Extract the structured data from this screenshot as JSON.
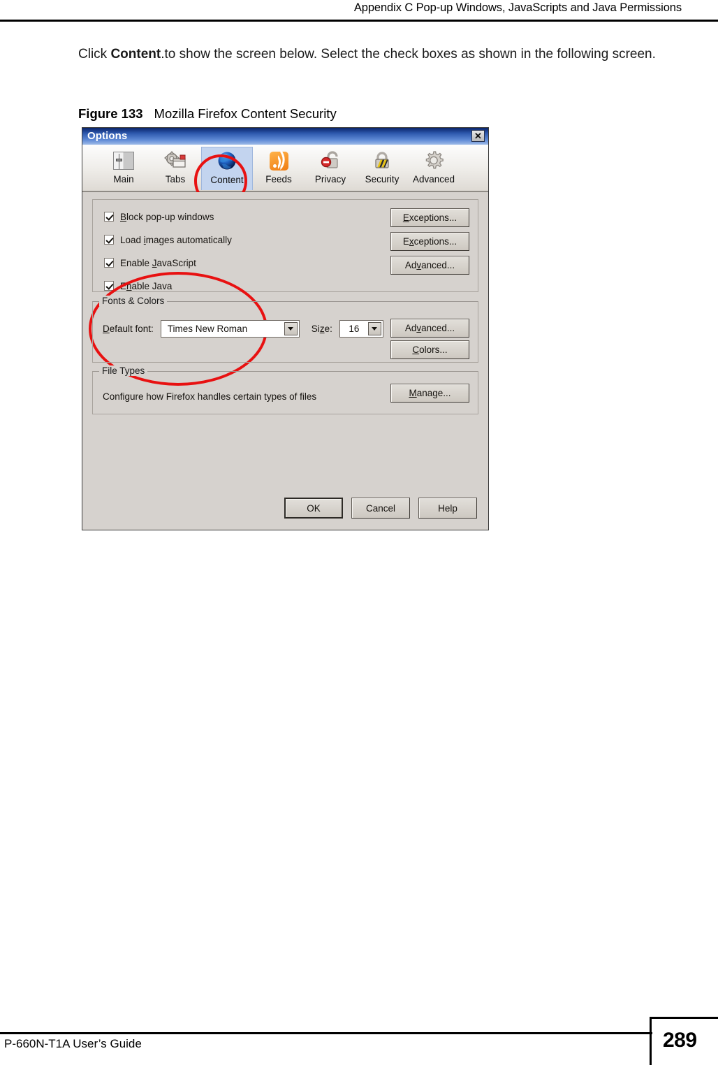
{
  "page": {
    "header": "Appendix C Pop-up Windows, JavaScripts and Java Permissions",
    "intro_before": "Click ",
    "intro_bold": "Content",
    "intro_after": ".to show the screen below. Select the check boxes as shown in the following screen.",
    "figure_number": "Figure 133",
    "figure_title": "Mozilla Firefox Content Security",
    "footer_left": "P-660N-T1A User’s Guide",
    "footer_page": "289"
  },
  "dialog": {
    "title": "Options",
    "close_label": "✕",
    "toolbar": [
      {
        "label": "Main",
        "icon": "sliders-icon",
        "selected": false
      },
      {
        "label": "Tabs",
        "icon": "tabs-icon",
        "selected": false
      },
      {
        "label": "Content",
        "icon": "globe-icon",
        "selected": true
      },
      {
        "label": "Feeds",
        "icon": "rss-icon",
        "selected": false
      },
      {
        "label": "Privacy",
        "icon": "unlock-icon",
        "selected": false
      },
      {
        "label": "Security",
        "icon": "padlock-icon",
        "selected": false
      },
      {
        "label": "Advanced",
        "icon": "gear-icon",
        "selected": false
      }
    ],
    "content": {
      "checkboxes": [
        {
          "label_pre": "",
          "accel": "B",
          "label_post": "lock pop-up windows",
          "checked": true
        },
        {
          "label_pre": "Load ",
          "accel": "i",
          "label_post": "mages automatically",
          "checked": true
        },
        {
          "label_pre": "Enable ",
          "accel": "J",
          "label_post": "avaScript",
          "checked": true
        },
        {
          "label_pre": "E",
          "accel": "n",
          "label_post": "able Java",
          "checked": true
        }
      ],
      "side_buttons": [
        {
          "pre": "",
          "accel": "E",
          "post": "xceptions..."
        },
        {
          "pre": "E",
          "accel": "x",
          "post": "ceptions..."
        },
        {
          "pre": "Ad",
          "accel": "v",
          "post": "anced..."
        }
      ]
    },
    "fonts_colors": {
      "group_title": "Fonts & Colors",
      "font_label_pre": "",
      "font_label_accel": "D",
      "font_label_post": "efault font:",
      "font_value": "Times New Roman",
      "size_label_pre": "Si",
      "size_label_accel": "z",
      "size_label_post": "e:",
      "size_value": "16",
      "advanced_pre": "Ad",
      "advanced_accel": "v",
      "advanced_post": "anced...",
      "colors_pre": "",
      "colors_accel": "C",
      "colors_post": "olors..."
    },
    "file_types": {
      "group_title": "File Types",
      "description": "Configure how Firefox handles certain types of files",
      "manage_pre": "",
      "manage_accel": "M",
      "manage_post": "anage..."
    },
    "footer_buttons": [
      {
        "label": "OK",
        "default": true
      },
      {
        "label": "Cancel",
        "default": false
      },
      {
        "label": "Help",
        "default": false
      }
    ]
  },
  "annotations": {
    "accent_color": "#e81111",
    "shapes": [
      "ellipse-around-content-tab",
      "ellipse-around-checkboxes"
    ]
  }
}
